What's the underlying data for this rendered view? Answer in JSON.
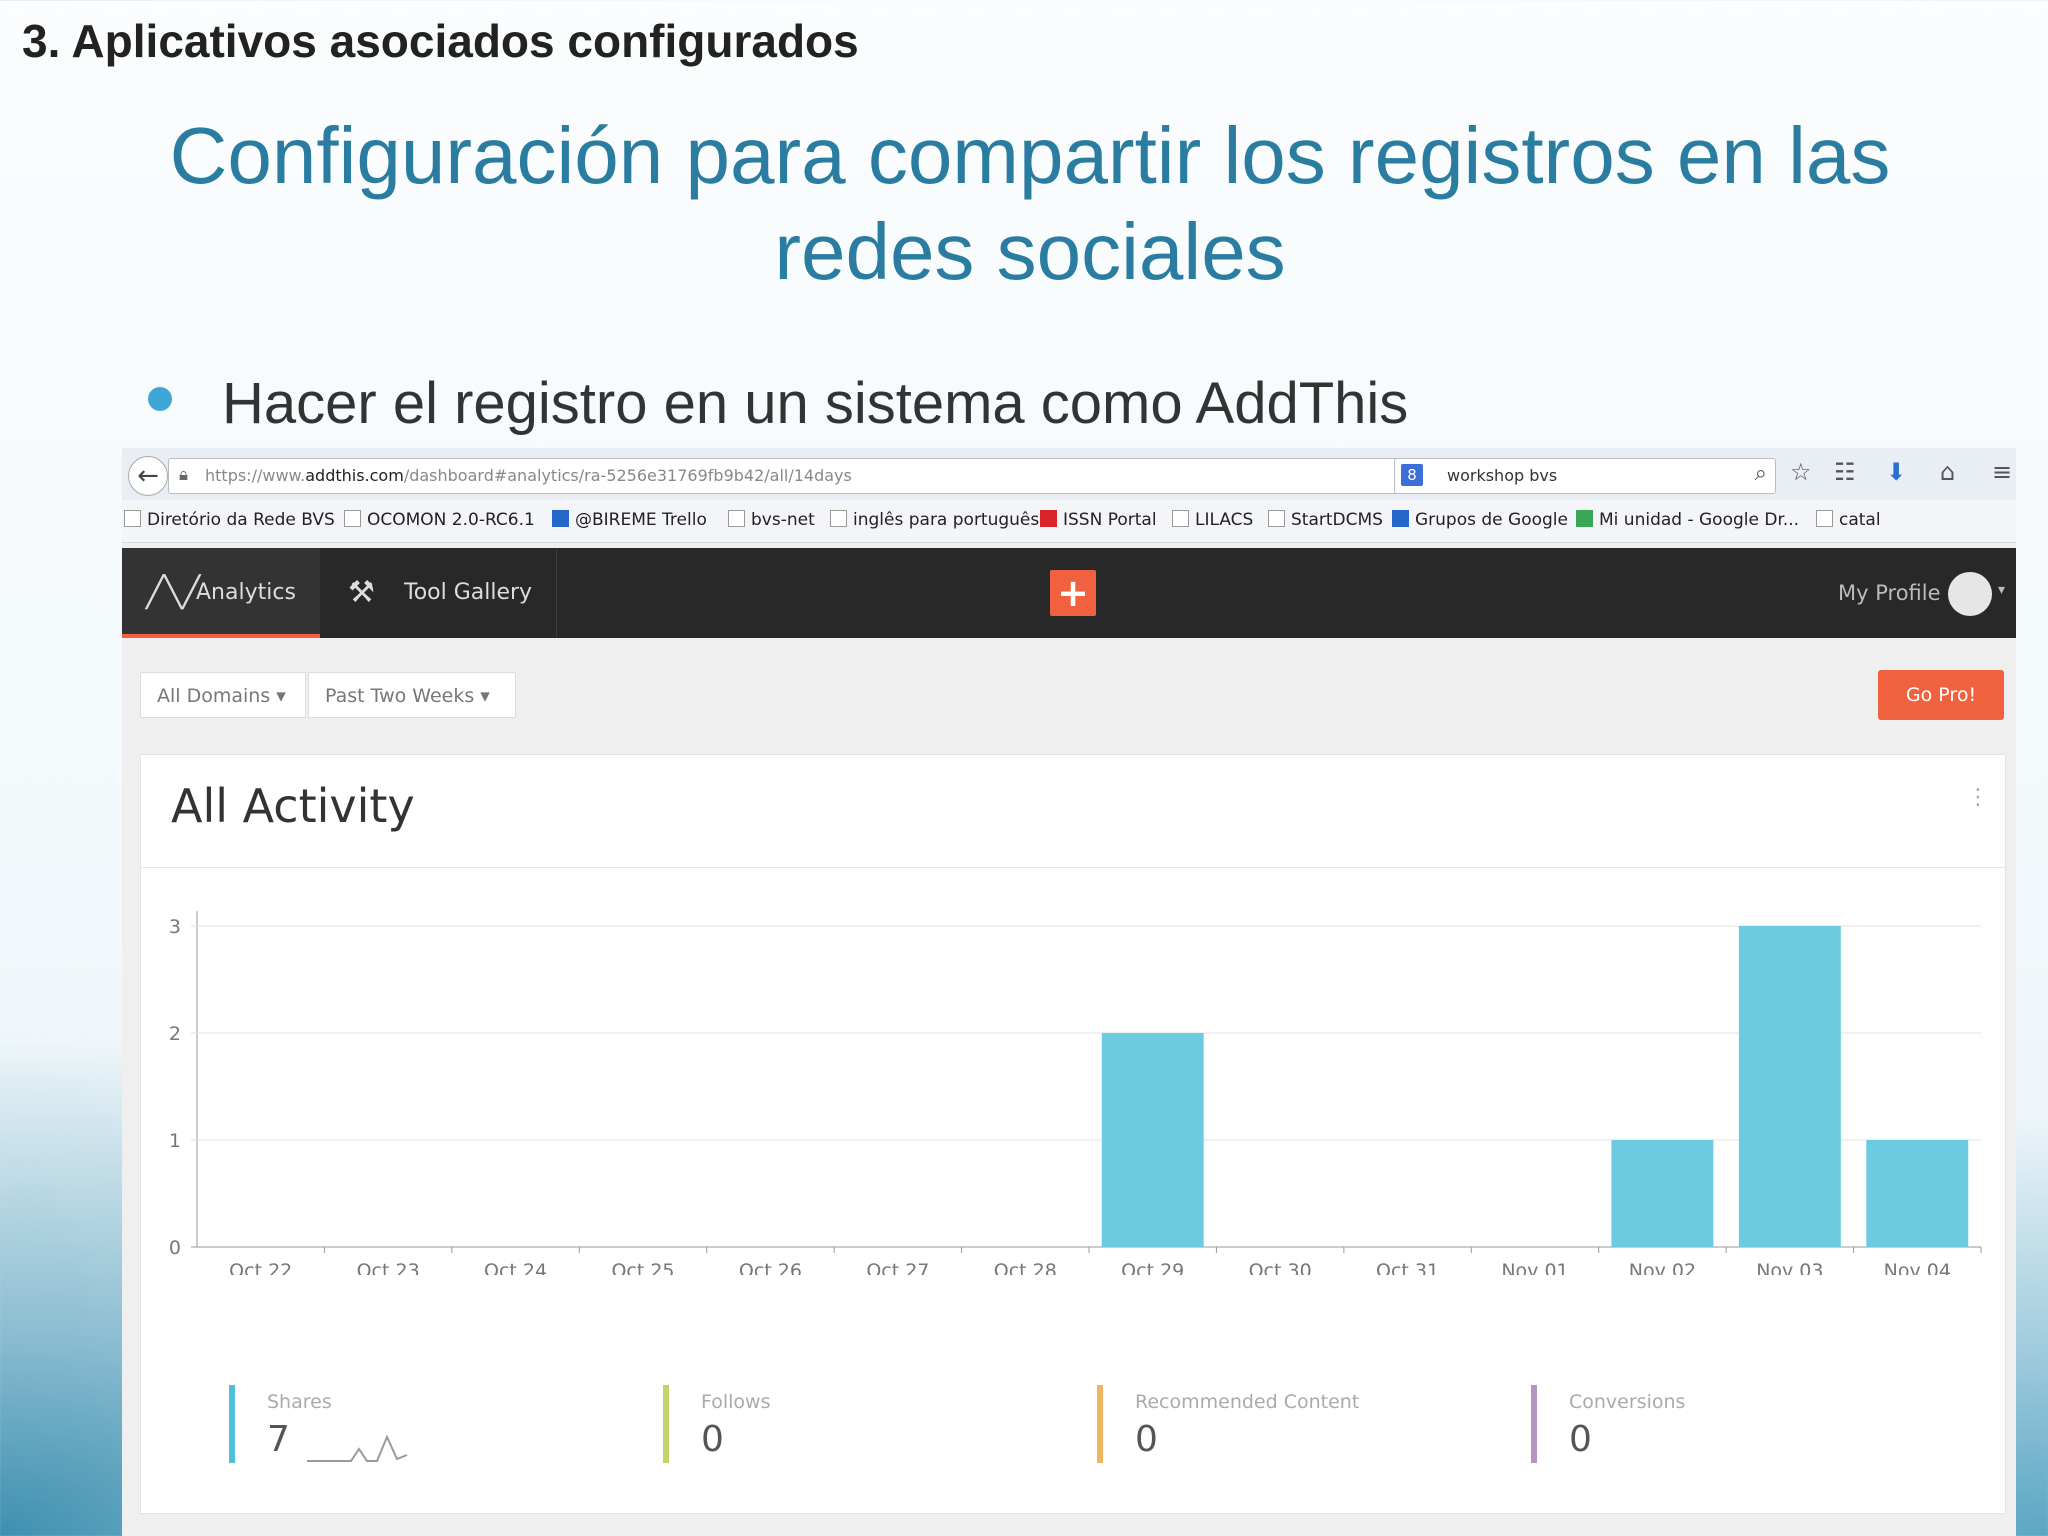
{
  "slide": {
    "heading": "3. Aplicativos asociados configurados",
    "title_line1": "Configuración para compartir los registros en las",
    "title_line2": "redes sociales",
    "bullet": "Hacer el registro en un sistema como AddThis"
  },
  "browser": {
    "url_prefix": "https://www.",
    "url_host": "addthis.com",
    "url_path": "/dashboard#analytics/ra-5256e31769fb9b42/all/14days",
    "search_query": "workshop bvs",
    "bookmarks": [
      "Diretório da Rede BVS",
      "OCOMON 2.0-RC6.1",
      "@BIREME Trello",
      "bvs-net",
      "inglês para português",
      "ISSN Portal",
      "LILACS",
      "StartDCMS",
      "Grupos de Google",
      "Mi unidad - Google Dr...",
      "catal"
    ]
  },
  "nav": {
    "analytics": "Analytics",
    "tool_gallery": "Tool Gallery",
    "plus": "+",
    "my_profile": "My Profile"
  },
  "filters": {
    "domains": "All Domains ▾",
    "period": "Past Two Weeks ▾",
    "go_pro": "Go Pro!"
  },
  "card": {
    "title": "All Activity",
    "menu": "⋮"
  },
  "chart_data": {
    "type": "bar",
    "categories": [
      "Oct 22",
      "Oct 23",
      "Oct 24",
      "Oct 25",
      "Oct 26",
      "Oct 27",
      "Oct 28",
      "Oct 29",
      "Oct 30",
      "Oct 31",
      "Nov 01",
      "Nov 02",
      "Nov 03",
      "Nov 04"
    ],
    "values": [
      0,
      0,
      0,
      0,
      0,
      0,
      0,
      2,
      0,
      0,
      0,
      1,
      3,
      1
    ],
    "yticks": [
      "0",
      "1",
      "2",
      "3"
    ],
    "ylim": [
      0,
      3.5
    ],
    "grid": true,
    "bar_color": "#6ccbe0"
  },
  "stats": [
    {
      "label": "Shares",
      "value": "7",
      "color": "#4fc0dc"
    },
    {
      "label": "Follows",
      "value": "0",
      "color": "#c4d46a"
    },
    {
      "label": "Recommended Content",
      "value": "0",
      "color": "#f0b560"
    },
    {
      "label": "Conversions",
      "value": "0",
      "color": "#b794c2"
    }
  ]
}
